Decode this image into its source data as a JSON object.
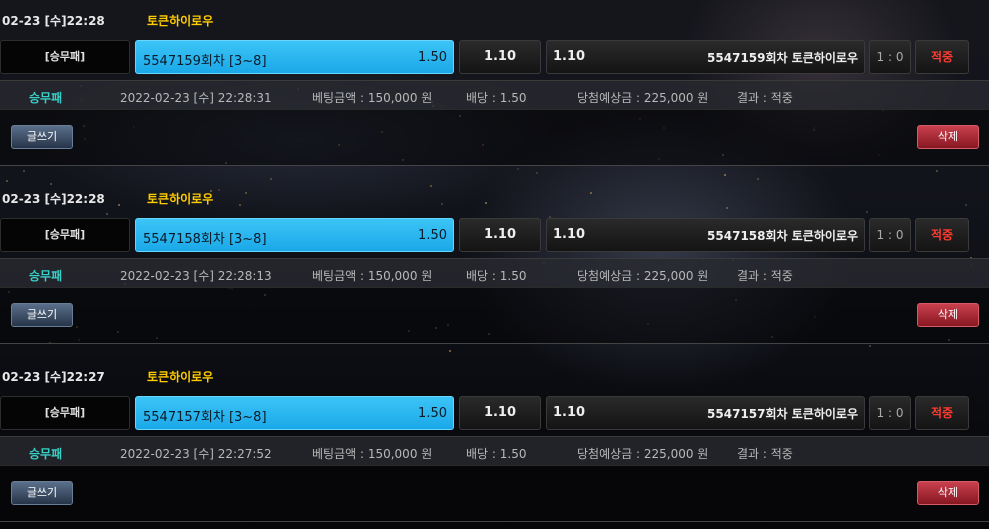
{
  "colors": {
    "pick_blue": "#22b0ec",
    "hit_red": "#ff3b30",
    "game_yellow": "#ffcc00",
    "type_teal": "#38d1c8"
  },
  "bets": [
    {
      "header": {
        "datetime": "02-23 [수]22:28",
        "game": "토큰하이로우"
      },
      "type_label": "[승무패]",
      "pick": {
        "label": "5547159회차 [3~8]",
        "odds": "1.50"
      },
      "mid_odds": "1.10",
      "opponent": {
        "odds": "1.10",
        "label": "5547159회차 토큰하이로우"
      },
      "score": "1 : 0",
      "result_badge": "적중",
      "info": {
        "type": "승무패",
        "datetime": "2022-02-23 [수] 22:28:31",
        "amount": "베팅금액 : 150,000 원",
        "odds": "배당 : 1.50",
        "expected": "당첨예상금 : 225,000 원",
        "result": "결과 : 적중"
      },
      "write_label": "글쓰기",
      "delete_label": "삭제"
    },
    {
      "header": {
        "datetime": "02-23 [수]22:28",
        "game": "토큰하이로우"
      },
      "type_label": "[승무패]",
      "pick": {
        "label": "5547158회차 [3~8]",
        "odds": "1.50"
      },
      "mid_odds": "1.10",
      "opponent": {
        "odds": "1.10",
        "label": "5547158회차 토큰하이로우"
      },
      "score": "1 : 0",
      "result_badge": "적중",
      "info": {
        "type": "승무패",
        "datetime": "2022-02-23 [수] 22:28:13",
        "amount": "베팅금액 : 150,000 원",
        "odds": "배당 : 1.50",
        "expected": "당첨예상금 : 225,000 원",
        "result": "결과 : 적중"
      },
      "write_label": "글쓰기",
      "delete_label": "삭제"
    },
    {
      "header": {
        "datetime": "02-23 [수]22:27",
        "game": "토큰하이로우"
      },
      "type_label": "[승무패]",
      "pick": {
        "label": "5547157회차 [3~8]",
        "odds": "1.50"
      },
      "mid_odds": "1.10",
      "opponent": {
        "odds": "1.10",
        "label": "5547157회차 토큰하이로우"
      },
      "score": "1 : 0",
      "result_badge": "적중",
      "info": {
        "type": "승무패",
        "datetime": "2022-02-23 [수] 22:27:52",
        "amount": "베팅금액 : 150,000 원",
        "odds": "배당 : 1.50",
        "expected": "당첨예상금 : 225,000 원",
        "result": "결과 : 적중"
      },
      "write_label": "글쓰기",
      "delete_label": "삭제"
    }
  ]
}
